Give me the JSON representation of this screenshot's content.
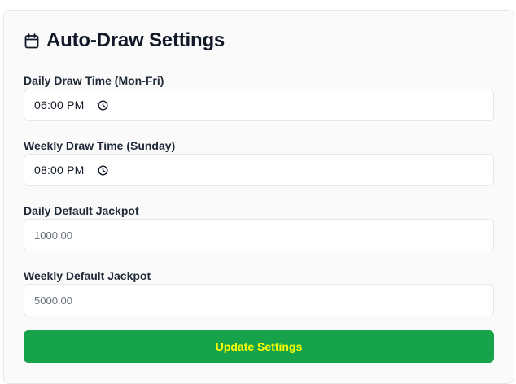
{
  "header": {
    "icon": "calendar-icon",
    "title": "Auto-Draw Settings"
  },
  "fields": {
    "daily_time": {
      "label": "Daily Draw Time (Mon-Fri)",
      "value": "06:00 PM",
      "icon": "clock-icon"
    },
    "weekly_time": {
      "label": "Weekly Draw Time (Sunday)",
      "value": "08:00 PM",
      "icon": "clock-icon"
    },
    "daily_jackpot": {
      "label": "Daily Default Jackpot",
      "placeholder": "1000.00"
    },
    "weekly_jackpot": {
      "label": "Weekly Default Jackpot",
      "placeholder": "5000.00"
    }
  },
  "submit": {
    "label": "Update Settings"
  },
  "colors": {
    "button_bg": "#16a34a",
    "button_text": "#ffff00",
    "border": "#e5e7eb"
  }
}
